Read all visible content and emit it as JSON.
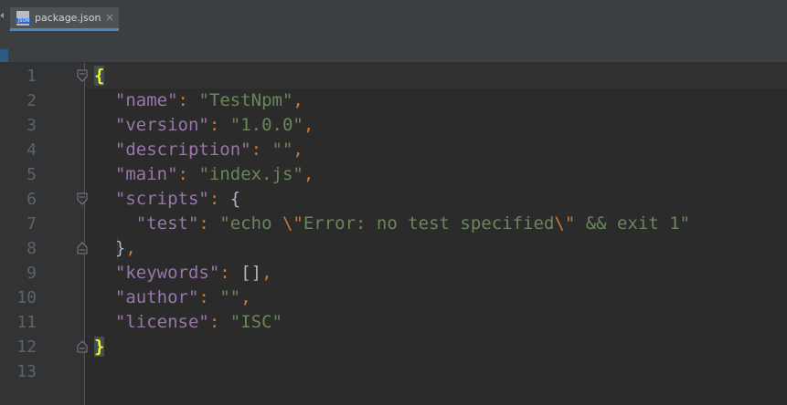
{
  "tab": {
    "icon_text": "JSON",
    "label": "package.json",
    "close_glyph": "×"
  },
  "gutter": {
    "line_numbers": [
      "1",
      "2",
      "3",
      "4",
      "5",
      "6",
      "7",
      "8",
      "9",
      "10",
      "11",
      "12",
      "13"
    ]
  },
  "code": {
    "line1_brace": "{",
    "line2_key": "\"name\"",
    "line2_colon": ":",
    "line2_value": "\"TestNpm\"",
    "line2_comma": ",",
    "line3_key": "\"version\"",
    "line3_colon": ":",
    "line3_value": "\"1.0.0\"",
    "line3_comma": ",",
    "line4_key": "\"description\"",
    "line4_colon": ":",
    "line4_value": "\"\"",
    "line4_comma": ",",
    "line5_key": "\"main\"",
    "line5_colon": ":",
    "line5_value": "\"index.js\"",
    "line5_comma": ",",
    "line6_key": "\"scripts\"",
    "line6_colon": ":",
    "line6_brace": "{",
    "line7_key": "\"test\"",
    "line7_colon": ":",
    "line7_value_a": "\"echo ",
    "line7_escape_a": "\\\"",
    "line7_value_b": "Error: no test specified",
    "line7_escape_b": "\\\"",
    "line7_value_c": " && exit 1\"",
    "line8_brace": "}",
    "line8_comma": ",",
    "line9_key": "\"keywords\"",
    "line9_colon": ":",
    "line9_value": "[]",
    "line9_comma": ",",
    "line10_key": "\"author\"",
    "line10_colon": ":",
    "line10_value": "\"\"",
    "line10_comma": ",",
    "line11_key": "\"license\"",
    "line11_colon": ":",
    "line11_value": "\"ISC\"",
    "line12_brace": "}"
  },
  "colors": {
    "key": "#9876aa",
    "string": "#6a8759",
    "punctuation": "#cc7832",
    "matched_brace": "#ffef28",
    "background": "#2b2b2b",
    "gutter": "#313335",
    "tab_underline": "#4a88c7"
  }
}
